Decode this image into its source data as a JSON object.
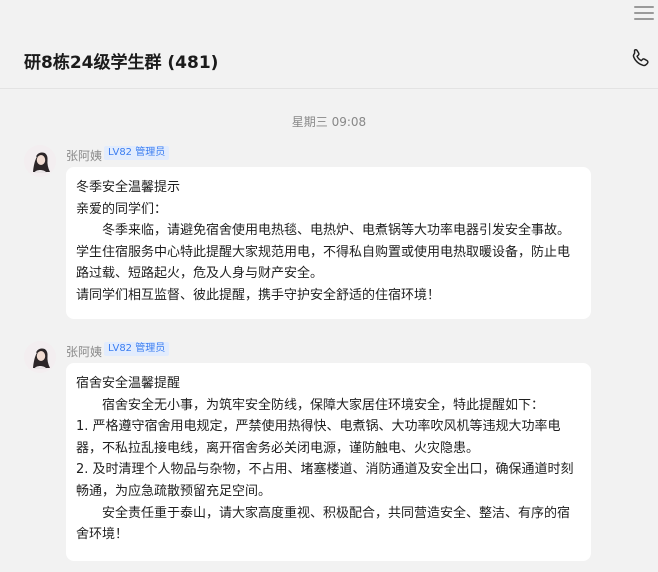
{
  "header": {
    "title": "研8栋24级学生群 (481)"
  },
  "chat": {
    "timestamp": "星期三 09:08",
    "messages": [
      {
        "sender": "张阿姨",
        "badge": "LV82 管理员",
        "lines": [
          "冬季安全温馨提示",
          "亲爱的同学们：",
          "冬季来临，请避免宿舍使用电热毯、电热炉、电煮锅等大功率电器引发安全事故。学生住宿服务中心特此提醒大家规范用电，不得私自购置或使用电热取暖设备，防止电路过载、短路起火，危及人身与财产安全。",
          "请同学们相互监督、彼此提醒，携手守护安全舒适的住宿环境！"
        ]
      },
      {
        "sender": "张阿姨",
        "badge": "LV82 管理员",
        "lines": [
          "宿舍安全温馨提醒",
          "宿舍安全无小事，为筑牢安全防线，保障大家居住环境安全，特此提醒如下：",
          "1. 严格遵守宿舍用电规定，严禁使用热得快、电煮锅、大功率吹风机等违规大功率电器，不私拉乱接电线，离开宿舍务必关闭电源，谨防触电、火灾隐患。",
          "2. 及时清理个人物品与杂物，不占用、堵塞楼道、消防通道及安全出口，确保通道时刻畅通，为应急疏散预留充足空间。",
          "安全责任重于泰山，请大家高度重视、积极配合，共同营造安全、整洁、有序的宿舍环境！"
        ]
      }
    ]
  }
}
